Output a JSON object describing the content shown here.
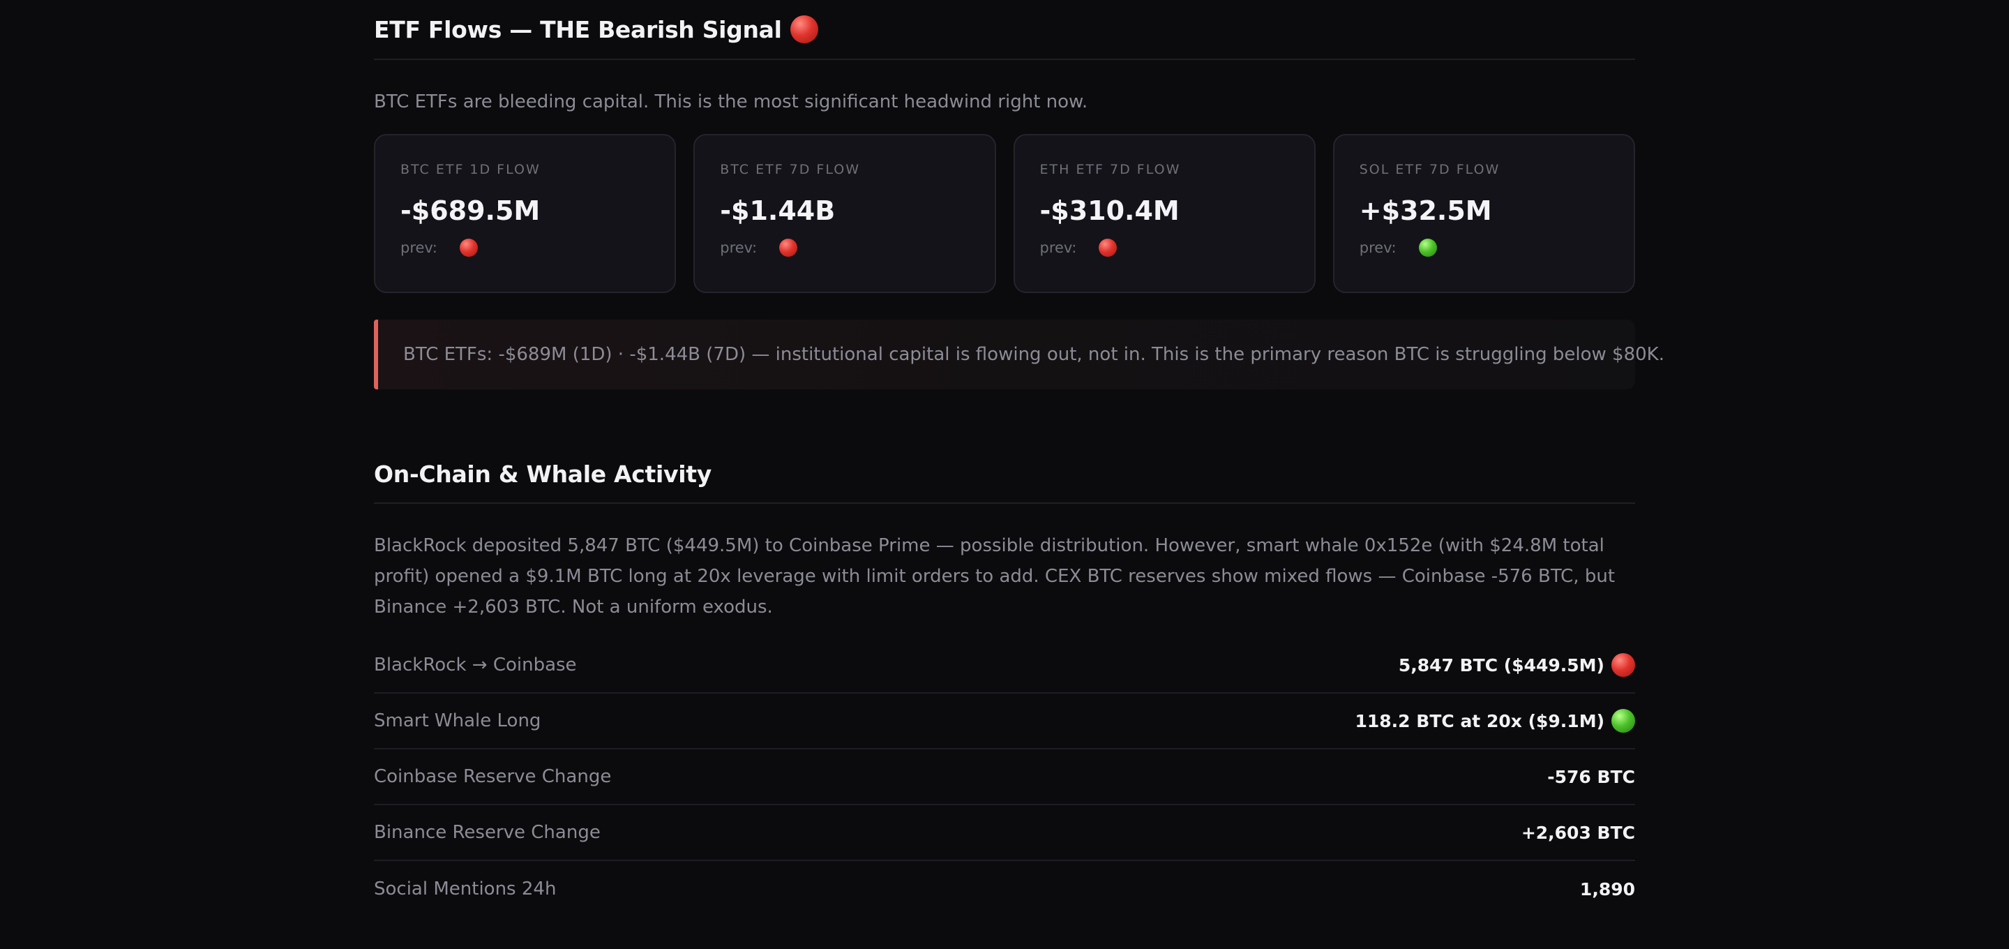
{
  "etf_section": {
    "title": "ETF Flows — THE Bearish Signal",
    "title_icon": "red-circle-icon",
    "description": "BTC ETFs are bleeding capital. This is the most significant headwind right now.",
    "cards": [
      {
        "label": "BTC ETF 1D FLOW",
        "value": "-$689.5M",
        "prev_label": "prev:",
        "prev_icon": "red-circle-icon"
      },
      {
        "label": "BTC ETF 7D FLOW",
        "value": "-$1.44B",
        "prev_label": "prev:",
        "prev_icon": "red-circle-icon"
      },
      {
        "label": "ETH ETF 7D FLOW",
        "value": "-$310.4M",
        "prev_label": "prev:",
        "prev_icon": "red-circle-icon"
      },
      {
        "label": "SOL ETF 7D FLOW",
        "value": "+$32.5M",
        "prev_label": "prev:",
        "prev_icon": "green-circle-icon"
      }
    ],
    "callout": "BTC ETFs: -$689M (1D) · -$1.44B (7D) — institutional capital is flowing out, not in. This is the primary reason BTC is struggling below $80K."
  },
  "onchain_section": {
    "title": "On-Chain & Whale Activity",
    "description": "BlackRock deposited 5,847 BTC ($449.5M) to Coinbase Prime — possible distribution. However, smart whale 0x152e (with $24.8M total profit) opened a $9.1M BTC long at 20x leverage with limit orders to add. CEX BTC reserves show mixed flows — Coinbase -576 BTC, but Binance +2,603 BTC. Not a uniform exodus.",
    "rows": [
      {
        "label": "BlackRock → Coinbase",
        "value": "5,847 BTC ($449.5M)",
        "icon": "red-circle-icon"
      },
      {
        "label": "Smart Whale Long",
        "value": "118.2 BTC at 20x ($9.1M)",
        "icon": "green-circle-icon"
      },
      {
        "label": "Coinbase Reserve Change",
        "value": "-576 BTC",
        "icon": ""
      },
      {
        "label": "Binance Reserve Change",
        "value": "+2,603 BTC",
        "icon": ""
      },
      {
        "label": "Social Mentions 24h",
        "value": "1,890",
        "icon": ""
      }
    ]
  },
  "colors": {
    "background": "#0b0b0d",
    "card_background": "#131319",
    "callout_accent": "#e0625a",
    "status_red": "#e0342e",
    "status_green": "#4cc22a"
  }
}
